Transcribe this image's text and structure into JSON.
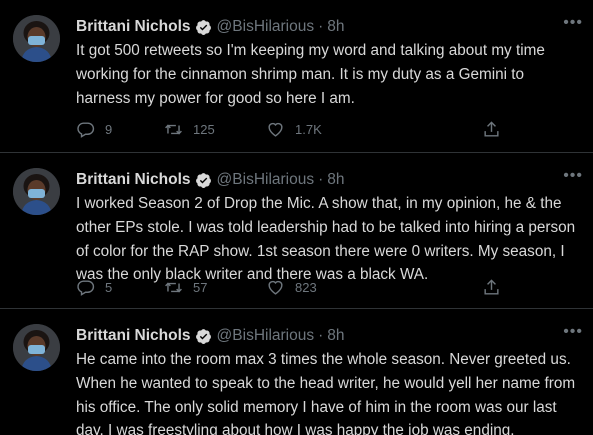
{
  "colors": {
    "background": "#000000",
    "text": "#d9d9d9",
    "muted": "#6e767d",
    "verified": "#1d9bf0",
    "divider": "#2f3336"
  },
  "icons": {
    "more": "more-horizontal-icon",
    "reply": "reply-icon",
    "retweet": "retweet-icon",
    "like": "heart-icon",
    "share": "share-icon",
    "verified": "verified-badge-icon"
  },
  "tweets": [
    {
      "author": {
        "name": "Brittani Nichols",
        "handle": "@BisHilarious"
      },
      "separator": "·",
      "time": "8h",
      "text": "It got 500 retweets so I'm keeping my word and talking about my time\nworking for the cinnamon shrimp man. It is my duty as a Gemini to\nharness my power for good so here I am.",
      "replies": "9",
      "retweets": "125",
      "likes": "1.7K"
    },
    {
      "author": {
        "name": "Brittani Nichols",
        "handle": "@BisHilarious"
      },
      "separator": "·",
      "time": "8h",
      "text": "I worked Season 2 of Drop the Mic. A show that, in my opinion, he & the\nother EPs stole. I was told leadership had to be talked into hiring a person\nof color for the RAP show. 1st season there were 0 writers. My season, I\nwas the only black writer and there was a black WA.",
      "replies": "5",
      "retweets": "57",
      "likes": "823"
    },
    {
      "author": {
        "name": "Brittani Nichols",
        "handle": "@BisHilarious"
      },
      "separator": "·",
      "time": "8h",
      "text": "He came into the room max 3 times the whole season. Never greeted us.\nWhen he wanted to speak to the head writer, he would yell her name from\nhis office. The only solid memory I have of him in the room was our last\nday. I was freestyling about how I was happy the job was ending."
    }
  ]
}
